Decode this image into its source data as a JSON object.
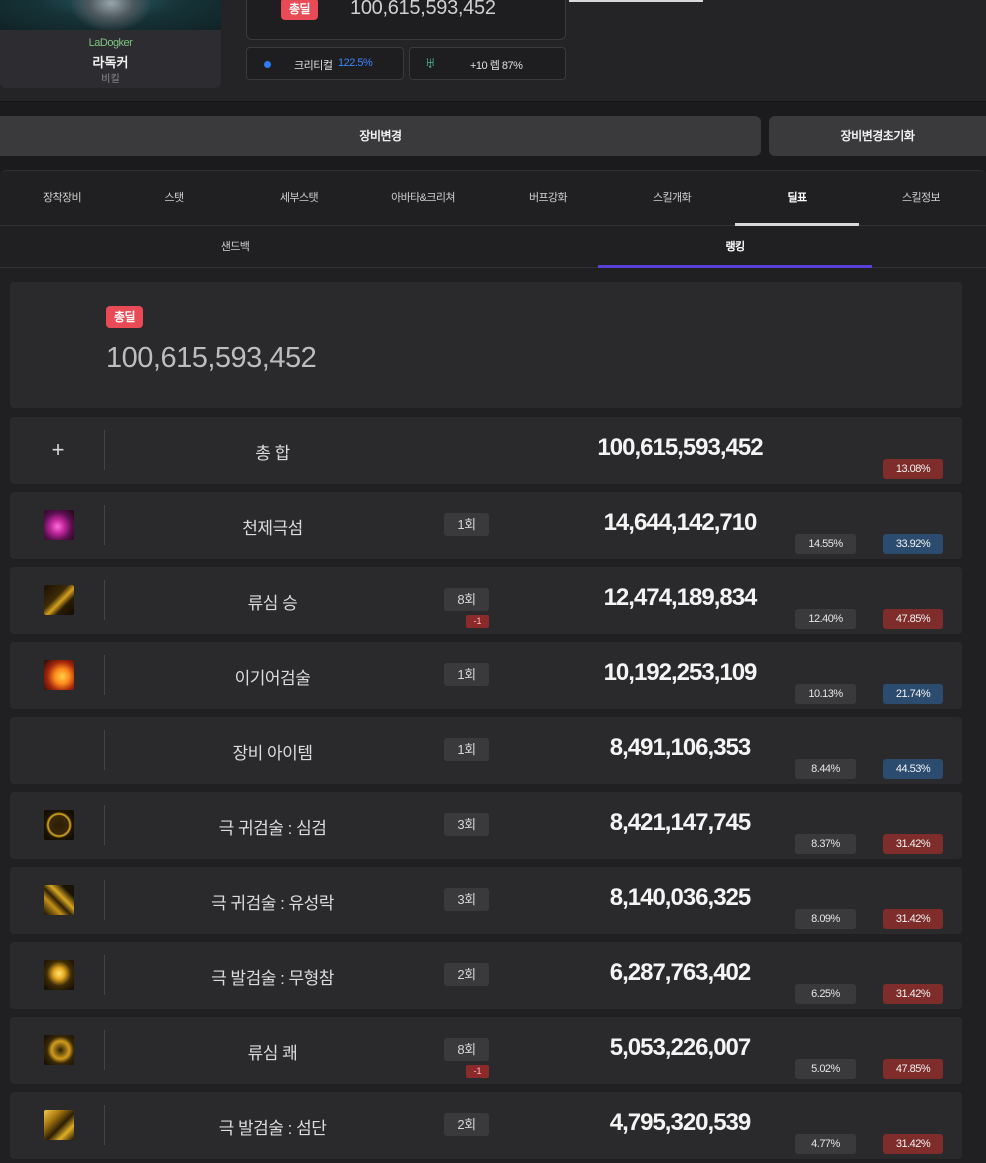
{
  "character": {
    "guild": "LaDogker",
    "name": "라독커",
    "class": "비킬"
  },
  "header": {
    "total_badge": "총딜",
    "total_value": "100,615,593,452",
    "crit_label": "크리티컬",
    "crit_value": "122.5%",
    "transcend_label": "+10 렙 87%"
  },
  "buttons": {
    "equip_change": "장비변경",
    "equip_reset": "장비변경초기화"
  },
  "main_tabs": [
    "장착장비",
    "스탯",
    "세부스탯",
    "아바타&크리쳐",
    "버프강화",
    "스킬개화",
    "딜표",
    "스킬정보"
  ],
  "active_main_tab": "딜표",
  "sub_tabs": [
    "샌드백",
    "랭킹"
  ],
  "active_sub_tab": "랭킹",
  "summary": {
    "badge": "총딜",
    "value": "100,615,593,452"
  },
  "rows": [
    {
      "name": "총 합",
      "damage": "100,615,593,452",
      "percent": "13.08%",
      "percent_color": "red",
      "icon": "plus-icon"
    },
    {
      "name": "천제극섬",
      "hits": "1회",
      "damage": "14,644,142,710",
      "share": "14.55%",
      "percent": "33.92%",
      "percent_color": "blue",
      "icon": "skill-icon-cheonje"
    },
    {
      "name": "류심 승",
      "hits": "8회",
      "hits_delta": "-1",
      "damage": "12,474,189,834",
      "share": "12.40%",
      "percent": "47.85%",
      "percent_color": "red",
      "icon": "skill-icon-ryusim-seung"
    },
    {
      "name": "이기어검술",
      "hits": "1회",
      "damage": "10,192,253,109",
      "share": "10.13%",
      "percent": "21.74%",
      "percent_color": "blue",
      "icon": "skill-icon-igieo"
    },
    {
      "name": "장비 아이템",
      "hits": "1회",
      "damage": "8,491,106,353",
      "share": "8.44%",
      "percent": "44.53%",
      "percent_color": "blue",
      "icon": ""
    },
    {
      "name": "극 귀검술 : 심검",
      "hits": "3회",
      "damage": "8,421,147,745",
      "share": "8.37%",
      "percent": "31.42%",
      "percent_color": "red",
      "icon": "skill-icon-simgeom"
    },
    {
      "name": "극 귀검술 : 유성락",
      "hits": "3회",
      "damage": "8,140,036,325",
      "share": "8.09%",
      "percent": "31.42%",
      "percent_color": "red",
      "icon": "skill-icon-yuseongrak"
    },
    {
      "name": "극 발검술 : 무형참",
      "hits": "2회",
      "damage": "6,287,763,402",
      "share": "6.25%",
      "percent": "31.42%",
      "percent_color": "red",
      "icon": "skill-icon-muhyeongcham"
    },
    {
      "name": "류심 쾌",
      "hits": "8회",
      "hits_delta": "-1",
      "damage": "5,053,226,007",
      "share": "5.02%",
      "percent": "47.85%",
      "percent_color": "red",
      "icon": "skill-icon-ryusim-kwae"
    },
    {
      "name": "극 발검술 : 섬단",
      "hits": "2회",
      "damage": "4,795,320,539",
      "share": "4.77%",
      "percent": "31.42%",
      "percent_color": "red",
      "icon": "skill-icon-seomdan"
    }
  ],
  "colors": {
    "badge_red": "#e84b55",
    "pct_red": "#7e2d2b",
    "pct_blue": "#2b4b6f",
    "crit_blue": "#3c86ff",
    "subtab_accent": "#5a3fd6"
  }
}
